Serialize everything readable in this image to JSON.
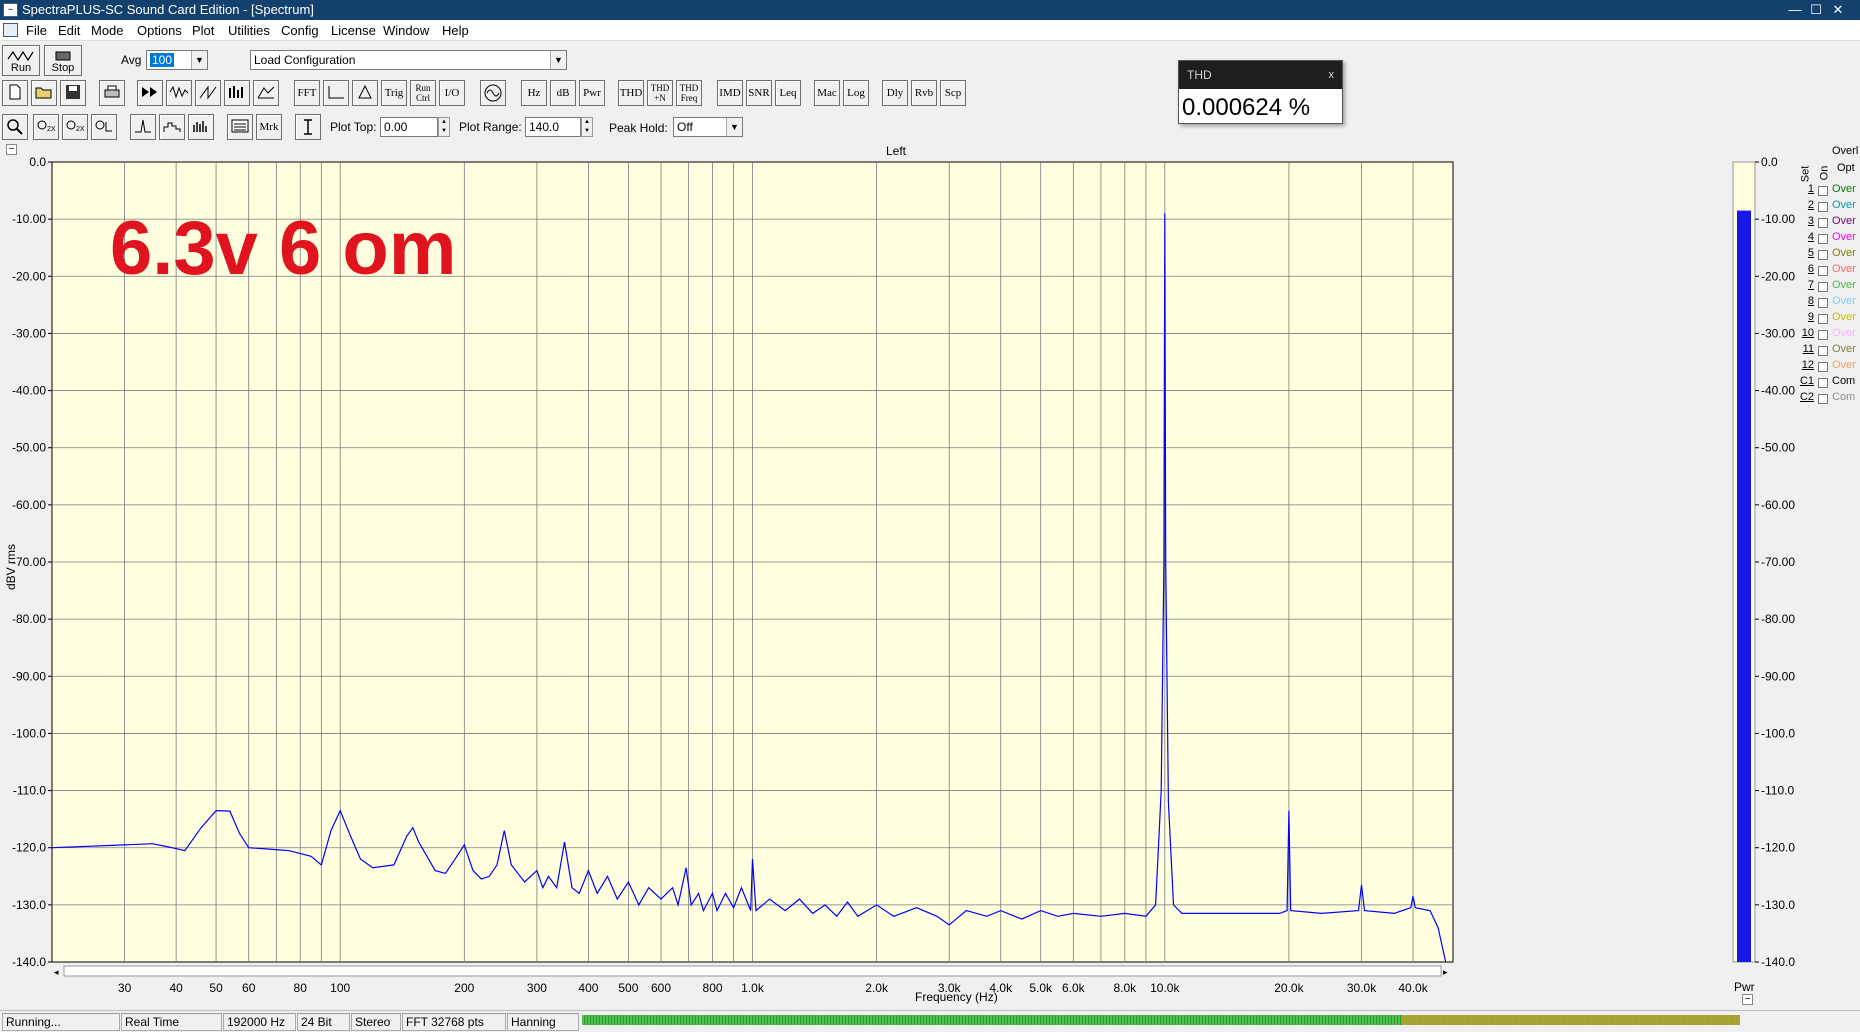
{
  "window": {
    "title": "SpectraPLUS-SC Sound Card Edition - [Spectrum]",
    "controls": {
      "minimize": "—",
      "maximize": "☐",
      "close": "✕"
    }
  },
  "menu": [
    "File",
    "Edit",
    "Mode",
    "Options",
    "Plot",
    "Utilities",
    "Config",
    "License",
    "Window",
    "Help"
  ],
  "toolbar": {
    "run_label": "Run",
    "stop_label": "Stop",
    "avg_label": "Avg",
    "avg_value": "100",
    "config_value": "Load Configuration",
    "row2_buttons": [
      "FFT",
      "Trig",
      "Run Ctrl",
      "I/O",
      "Hz",
      "dB",
      "Pwr",
      "THD",
      "THD +N",
      "THD Freq",
      "IMD",
      "SNR",
      "Leq",
      "Mac",
      "Log",
      "Dly",
      "Rvb",
      "Scp"
    ],
    "row3_buttons": [
      "Mrk"
    ],
    "plot_top_label": "Plot Top:",
    "plot_top_value": "0.00",
    "plot_range_label": "Plot Range:",
    "plot_range_value": "140.0",
    "peak_hold_label": "Peak Hold:",
    "peak_hold_value": "Off"
  },
  "thd_window": {
    "title": "THD",
    "close": "x",
    "value": "0.000624 %"
  },
  "plot": {
    "channel_title": "Left",
    "annotation": "6.3v 6 om",
    "xlabel": "Frequency (Hz)",
    "ylabel": "dBV rms",
    "collapse_icon": "−",
    "meter_label": "Pwr"
  },
  "chart_data": {
    "type": "line",
    "title": "Left",
    "xlabel": "Frequency (Hz)",
    "ylabel": "dBV rms",
    "xscale": "log",
    "xlim": [
      20,
      50000
    ],
    "ylim": [
      -140,
      0
    ],
    "grid": true,
    "background": "#ffffe0",
    "line_color": "#0000ff",
    "y_ticks": [
      "0.0",
      "-10.00",
      "-20.00",
      "-30.00",
      "-40.00",
      "-50.00",
      "-60.00",
      "-70.00",
      "-80.00",
      "-90.00",
      "-100.0",
      "-110.0",
      "-120.0",
      "-130.0",
      "-140.0"
    ],
    "x_tick_labels": [
      {
        "f": 30,
        "label": "30"
      },
      {
        "f": 40,
        "label": "40"
      },
      {
        "f": 50,
        "label": "50"
      },
      {
        "f": 60,
        "label": "60"
      },
      {
        "f": 80,
        "label": "80"
      },
      {
        "f": 100,
        "label": "100"
      },
      {
        "f": 200,
        "label": "200"
      },
      {
        "f": 300,
        "label": "300"
      },
      {
        "f": 400,
        "label": "400"
      },
      {
        "f": 500,
        "label": "500"
      },
      {
        "f": 600,
        "label": "600"
      },
      {
        "f": 800,
        "label": "800"
      },
      {
        "f": 1000,
        "label": "1.0k"
      },
      {
        "f": 2000,
        "label": "2.0k"
      },
      {
        "f": 3000,
        "label": "3.0k"
      },
      {
        "f": 4000,
        "label": "4.0k"
      },
      {
        "f": 5000,
        "label": "5.0k"
      },
      {
        "f": 6000,
        "label": "6.0k"
      },
      {
        "f": 8000,
        "label": "8.0k"
      },
      {
        "f": 10000,
        "label": "10.0k"
      },
      {
        "f": 20000,
        "label": "20.0k"
      },
      {
        "f": 30000,
        "label": "30.0k"
      },
      {
        "f": 40000,
        "label": "40.0k"
      }
    ],
    "x_grid": [
      30,
      40,
      50,
      60,
      70,
      80,
      90,
      100,
      200,
      300,
      400,
      500,
      600,
      700,
      800,
      900,
      1000,
      2000,
      3000,
      4000,
      5000,
      6000,
      7000,
      8000,
      9000,
      10000,
      20000,
      30000,
      40000
    ],
    "series": [
      {
        "points": [
          [
            20,
            -120
          ],
          [
            30,
            -119.5
          ],
          [
            35,
            -119.3
          ],
          [
            38,
            -119.8
          ],
          [
            42,
            -120.5
          ],
          [
            46,
            -116.5
          ],
          [
            50,
            -113.5
          ],
          [
            54,
            -113.6
          ],
          [
            57,
            -117.5
          ],
          [
            60,
            -120
          ],
          [
            66,
            -120.2
          ],
          [
            75,
            -120.5
          ],
          [
            85,
            -121.5
          ],
          [
            90,
            -123
          ],
          [
            95,
            -117
          ],
          [
            100,
            -113.5
          ],
          [
            106,
            -118
          ],
          [
            112,
            -122
          ],
          [
            120,
            -123.5
          ],
          [
            135,
            -123
          ],
          [
            145,
            -118
          ],
          [
            150,
            -116.5
          ],
          [
            155,
            -119
          ],
          [
            170,
            -124
          ],
          [
            180,
            -124.5
          ],
          [
            190,
            -122
          ],
          [
            200,
            -119.5
          ],
          [
            210,
            -124
          ],
          [
            220,
            -125.5
          ],
          [
            230,
            -125
          ],
          [
            240,
            -123
          ],
          [
            250,
            -117
          ],
          [
            260,
            -123
          ],
          [
            280,
            -126
          ],
          [
            300,
            -124
          ],
          [
            310,
            -127
          ],
          [
            320,
            -125
          ],
          [
            335,
            -127
          ],
          [
            350,
            -119
          ],
          [
            365,
            -127
          ],
          [
            380,
            -128
          ],
          [
            400,
            -124
          ],
          [
            420,
            -128
          ],
          [
            445,
            -125
          ],
          [
            470,
            -129
          ],
          [
            500,
            -126
          ],
          [
            530,
            -130
          ],
          [
            560,
            -127
          ],
          [
            600,
            -129
          ],
          [
            640,
            -127
          ],
          [
            660,
            -130
          ],
          [
            690,
            -123.5
          ],
          [
            710,
            -130
          ],
          [
            740,
            -128
          ],
          [
            760,
            -131
          ],
          [
            800,
            -128
          ],
          [
            820,
            -131
          ],
          [
            860,
            -128
          ],
          [
            900,
            -130.5
          ],
          [
            940,
            -127
          ],
          [
            990,
            -131
          ],
          [
            1000,
            -122
          ],
          [
            1020,
            -131
          ],
          [
            1100,
            -129
          ],
          [
            1200,
            -131
          ],
          [
            1300,
            -129
          ],
          [
            1400,
            -131.5
          ],
          [
            1500,
            -130
          ],
          [
            1600,
            -132
          ],
          [
            1700,
            -129.5
          ],
          [
            1800,
            -132
          ],
          [
            2000,
            -130
          ],
          [
            2200,
            -132
          ],
          [
            2500,
            -130.5
          ],
          [
            2800,
            -132
          ],
          [
            3000,
            -133.5
          ],
          [
            3300,
            -131
          ],
          [
            3700,
            -132
          ],
          [
            4000,
            -131
          ],
          [
            4500,
            -132.5
          ],
          [
            5000,
            -131
          ],
          [
            5500,
            -132
          ],
          [
            6000,
            -131.5
          ],
          [
            7000,
            -132
          ],
          [
            8000,
            -131.5
          ],
          [
            9000,
            -132
          ],
          [
            9500,
            -130
          ],
          [
            9800,
            -110
          ],
          [
            9950,
            -70
          ],
          [
            10000,
            -9
          ],
          [
            10050,
            -70
          ],
          [
            10200,
            -112
          ],
          [
            10500,
            -130
          ],
          [
            11000,
            -131.5
          ],
          [
            13000,
            -131.5
          ],
          [
            16000,
            -131.5
          ],
          [
            19000,
            -131.5
          ],
          [
            19800,
            -131
          ],
          [
            20000,
            -113.5
          ],
          [
            20200,
            -131
          ],
          [
            24000,
            -131.5
          ],
          [
            29500,
            -131
          ],
          [
            30000,
            -126.5
          ],
          [
            30500,
            -131
          ],
          [
            36000,
            -131.5
          ],
          [
            39500,
            -130.5
          ],
          [
            40000,
            -128.5
          ],
          [
            40500,
            -130.5
          ],
          [
            44000,
            -131
          ],
          [
            46000,
            -134
          ],
          [
            48000,
            -140
          ]
        ]
      }
    ],
    "meter_level_db": -8.5
  },
  "overlays": {
    "header": "Overl",
    "set_label": "Set",
    "on_label": "On",
    "opt_label": "Opt",
    "rows": [
      {
        "num": "1",
        "label": "Over",
        "color": "#008000"
      },
      {
        "num": "2",
        "label": "Over",
        "color": "#00a0a0"
      },
      {
        "num": "3",
        "label": "Over",
        "color": "#800080"
      },
      {
        "num": "4",
        "label": "Over",
        "color": "#ff00ff"
      },
      {
        "num": "5",
        "label": "Over",
        "color": "#808000"
      },
      {
        "num": "6",
        "label": "Over",
        "color": "#ff6666"
      },
      {
        "num": "7",
        "label": "Over",
        "color": "#40c040"
      },
      {
        "num": "8",
        "label": "Over",
        "color": "#80d0ff"
      },
      {
        "num": "9",
        "label": "Over",
        "color": "#c0c000"
      },
      {
        "num": "10",
        "label": "Over",
        "color": "#ffb0ff"
      },
      {
        "num": "11",
        "label": "Over",
        "color": "#808040"
      },
      {
        "num": "12",
        "label": "Over",
        "color": "#ffa060"
      },
      {
        "num": "C1",
        "label": "Com",
        "color": "#000000"
      },
      {
        "num": "C2",
        "label": "Com",
        "color": "#909090"
      }
    ]
  },
  "status": {
    "state": "Running...",
    "mode": "Real Time",
    "sample_rate": "192000 Hz",
    "bits": "24 Bit",
    "channels": "Stereo",
    "fft": "FFT 32768 pts",
    "window": "Hanning"
  }
}
